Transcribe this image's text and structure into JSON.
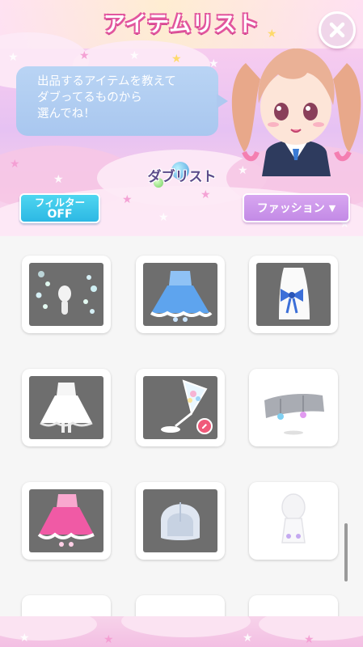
{
  "header": {
    "title": "アイテムリスト",
    "close_icon": "close-icon",
    "message_lines": [
      "出品するアイテムを教えて",
      "ダブってるものから",
      "選んでね！"
    ],
    "subtitle": "ダブリスト"
  },
  "controls": {
    "filter_label_line1": "フィルター",
    "filter_label_line2": "OFF",
    "category_label": "ファッション",
    "category_arrow": "▼"
  },
  "items": [
    {
      "name": "item-bubble-effect",
      "icon": "bubbles"
    },
    {
      "name": "item-blue-dress",
      "icon": "blue-dress"
    },
    {
      "name": "item-ribbon-top",
      "icon": "ribbon-top"
    },
    {
      "name": "item-white-dress",
      "icon": "white-dress"
    },
    {
      "name": "item-parfait-glass",
      "icon": "parfait-glass",
      "badge": "edit-icon"
    },
    {
      "name": "item-gem-accessory",
      "icon": "gem-accessory"
    },
    {
      "name": "item-pink-dress",
      "icon": "pink-dress"
    },
    {
      "name": "item-bob-hair",
      "icon": "bob-hair"
    },
    {
      "name": "item-white-body",
      "icon": "white-body"
    }
  ],
  "colors": {
    "title_outline": "#e2569e",
    "filter_button": "#2cb8e4",
    "category_button": "#c38ae6",
    "bubble": "#a9c7ef",
    "thumb_bg": "#6e6e6e"
  }
}
